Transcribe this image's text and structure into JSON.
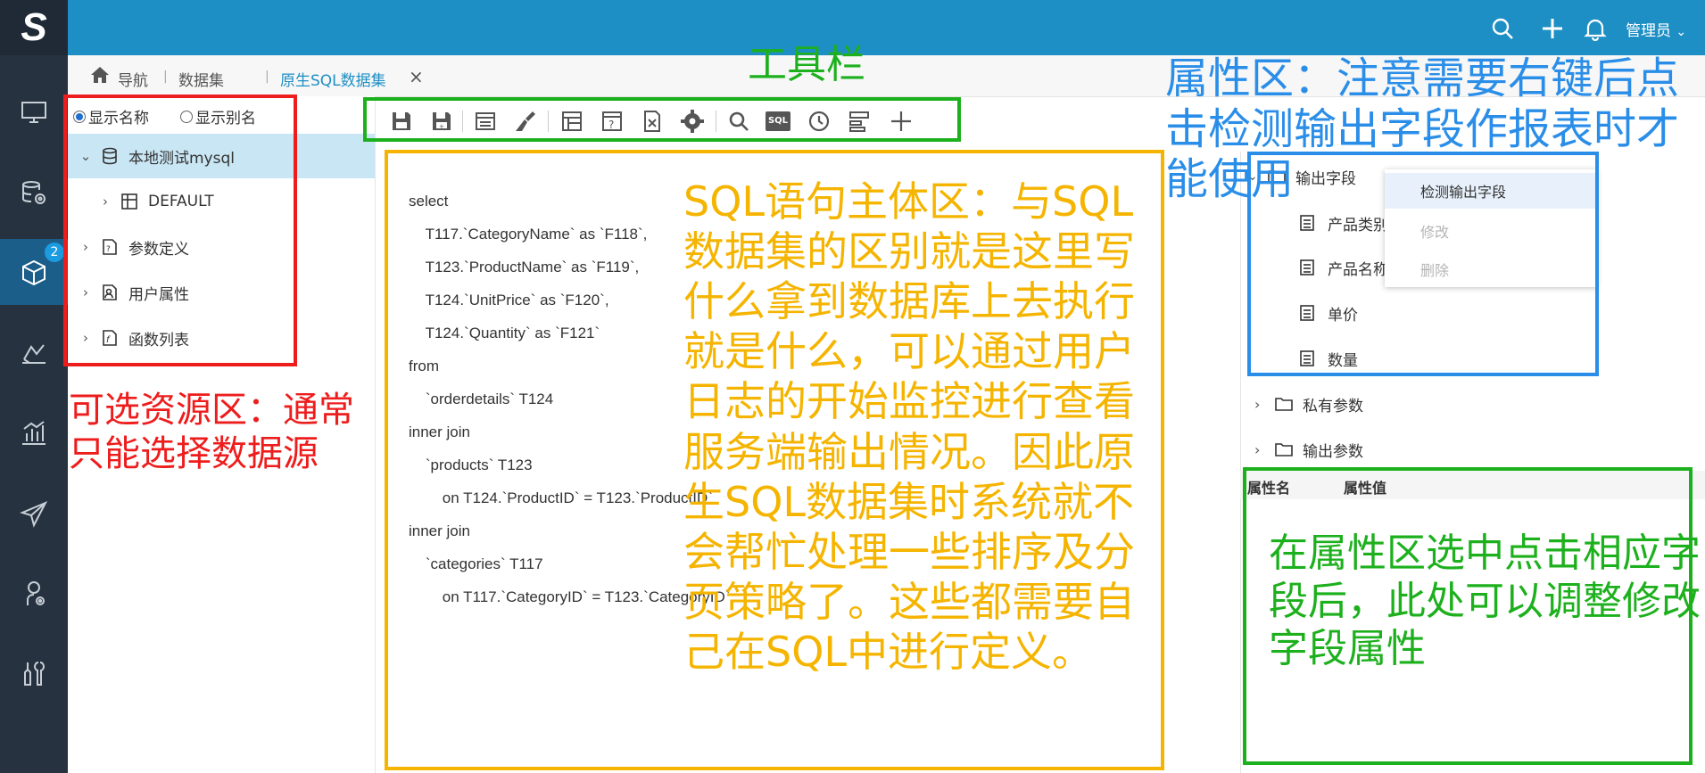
{
  "app": {
    "logo_letter": "S",
    "badge_count": "2",
    "user_label": "管理员"
  },
  "breadcrumb": {
    "nav": "导航",
    "dataset": "数据集",
    "active_tab": "原生SQL数据集",
    "close": "×"
  },
  "left_nav_icons": [
    "monitor-icon",
    "database-settings-icon",
    "cube-icon",
    "analysis-icon",
    "chart-icon",
    "send-icon",
    "user-settings-icon",
    "tools-icon"
  ],
  "resource_panel": {
    "show_name": "显示名称",
    "show_alias": "显示别名",
    "items": [
      {
        "label": "本地测试mysql",
        "icon": "database-icon",
        "expanded": true
      },
      {
        "label": "DEFAULT",
        "icon": "schema-icon"
      },
      {
        "label": "参数定义",
        "icon": "param-icon"
      },
      {
        "label": "用户属性",
        "icon": "user-attr-icon"
      },
      {
        "label": "函数列表",
        "icon": "function-icon"
      }
    ]
  },
  "toolbar": {
    "icons": [
      "save-icon",
      "save-as-icon",
      "preview-icon",
      "clear-icon",
      "table-icon",
      "param-window-icon",
      "export-icon",
      "settings-icon",
      "search-icon",
      "sql-icon",
      "history-icon",
      "format-icon",
      "add-icon"
    ],
    "sql_icon_label": "SQL"
  },
  "sql": {
    "lines": [
      "select",
      "    T117.`CategoryName` as `F118`,",
      "    T123.`ProductName` as `F119`,",
      "    T124.`UnitPrice` as `F120`,",
      "    T124.`Quantity` as `F121`",
      "from",
      "    `orderdetails` T124",
      "inner join",
      "    `products` T123",
      "        on T124.`ProductID` = T123.`ProductID`",
      "inner join",
      "    `categories` T117",
      "        on T117.`CategoryID` = T123.`CategoryID`"
    ]
  },
  "property_panel": {
    "output_fields": "输出字段",
    "fields": [
      "产品类别",
      "产品名称",
      "单价",
      "数量"
    ],
    "private_params": "私有参数",
    "output_params": "输出参数",
    "col_name": "属性名",
    "col_value": "属性值",
    "context_menu": {
      "detect": "检测输出字段",
      "modify": "修改",
      "delete": "删除"
    }
  },
  "annotations": {
    "resource": "可选资源区：通常只能选择数据源",
    "toolbar": "工具栏",
    "sql": "SQL语句主体区：与SQL数据集的区别就是这里写什么拿到数据库上去执行就是什么，可以通过用户日志的开始监控进行查看服务端输出情况。因此原生SQL数据集时系统就不会帮忙处理一些排序及分页策略了。这些都需要自己在SQL中进行定义。",
    "property": "属性区：注意需要右键后点击检测输出字段作报表时才能使用",
    "field_props": "在属性区选中点击相应字段后，此处可以调整修改字段属性"
  },
  "colors": {
    "topbar": "#1e8fc4",
    "left_nav": "#263240",
    "red_box": "#ee1d1d",
    "green_box": "#1db01d",
    "yellow_box": "#f5b400",
    "blue_box": "#2a8ee8"
  }
}
